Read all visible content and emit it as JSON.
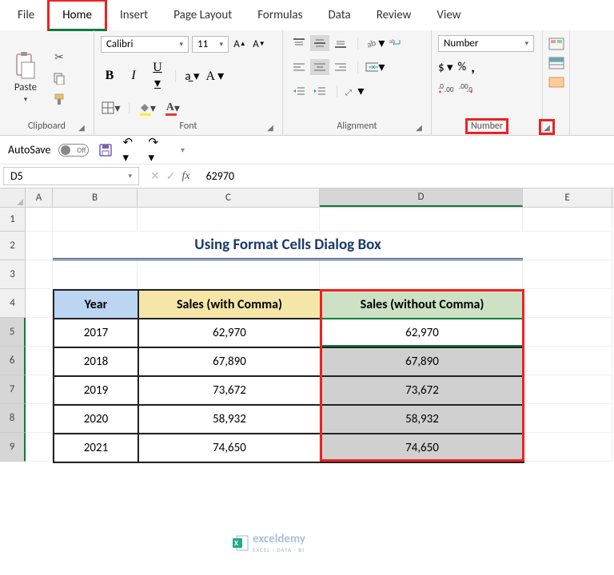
{
  "tabs": {
    "file": "File",
    "home": "Home",
    "insert": "Insert",
    "pagelayout": "Page Layout",
    "formulas": "Formulas",
    "data": "Data",
    "review": "Review",
    "view": "View"
  },
  "ribbon": {
    "clipboard": {
      "paste": "Paste",
      "label": "Clipboard"
    },
    "font": {
      "name": "Calibri",
      "size": "11",
      "label": "Font"
    },
    "alignment": {
      "label": "Alignment"
    },
    "number": {
      "format": "Number",
      "label": "Number"
    }
  },
  "qat": {
    "autosave": "AutoSave",
    "off": "Off"
  },
  "namebox": "D5",
  "formula": "62970",
  "columns": {
    "A": "A",
    "B": "B",
    "C": "C",
    "D": "D",
    "E": "E"
  },
  "rows": {
    "1": "1",
    "2": "2",
    "3": "3",
    "4": "4",
    "5": "5",
    "6": "6",
    "7": "7",
    "8": "8",
    "9": "9"
  },
  "title": "Using Format Cells Dialog Box",
  "headers": {
    "year": "Year",
    "withComma": "Sales (with Comma)",
    "withoutComma": "Sales (without Comma)"
  },
  "data": [
    {
      "year": "2017",
      "c": "62,970",
      "d": "62,970"
    },
    {
      "year": "2018",
      "c": "67,890",
      "d": "67,890"
    },
    {
      "year": "2019",
      "c": "73,672",
      "d": "73,672"
    },
    {
      "year": "2020",
      "c": "58,932",
      "d": "58,932"
    },
    {
      "year": "2021",
      "c": "74,650",
      "d": "74,650"
    }
  ],
  "watermark": {
    "brand": "exceldemy",
    "sub": "EXCEL · DATA · BI"
  }
}
